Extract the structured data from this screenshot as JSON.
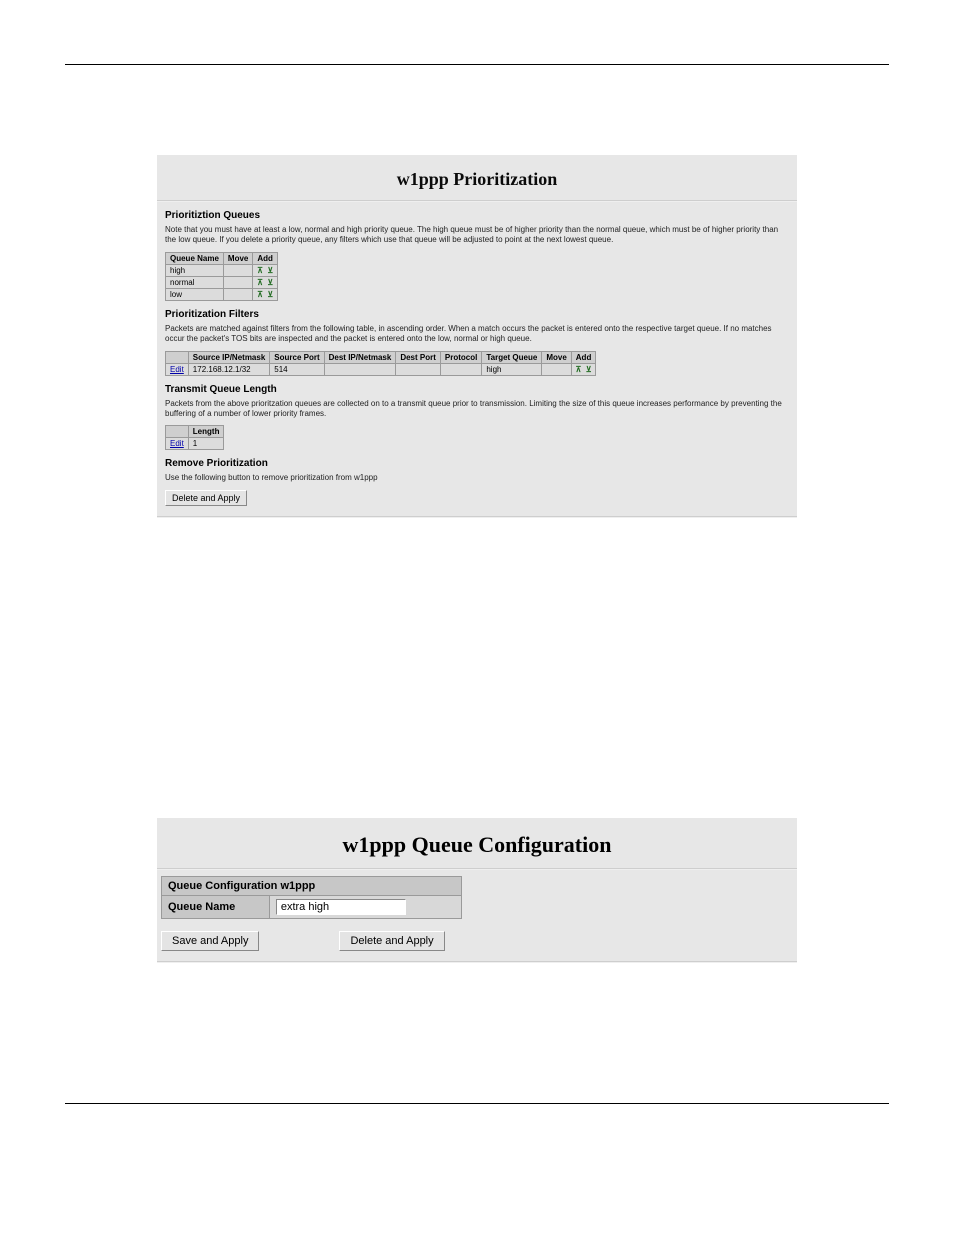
{
  "panel1": {
    "title": "w1ppp Prioritization",
    "sect_queues": {
      "heading": "Prioritiztion Queues",
      "note": "Note that you must have at least a low, normal and high priority queue. The high queue must be of higher priority than the normal queue, which must be of higher priority than the low queue. If you delete a priority queue, any filters which use that queue will be adjusted to point at the next lowest queue.",
      "hdr_name": "Queue Name",
      "hdr_move": "Move",
      "hdr_add": "Add",
      "rows": [
        {
          "name": "high"
        },
        {
          "name": "normal"
        },
        {
          "name": "low"
        }
      ]
    },
    "sect_filters": {
      "heading": "Prioritization Filters",
      "note": "Packets are matched against filters from the following table, in ascending order. When a match occurs the packet is entered onto the respective target queue. If no matches occur the packet's TOS bits are inspected and the packet is entered onto the low, normal or high queue.",
      "hdr_blank": "",
      "hdr_src_ip": "Source IP/Netmask",
      "hdr_src_port": "Source Port",
      "hdr_dest_ip": "Dest IP/Netmask",
      "hdr_dest_port": "Dest Port",
      "hdr_proto": "Protocol",
      "hdr_target": "Target Queue",
      "hdr_move": "Move",
      "hdr_add": "Add",
      "row": {
        "edit": "Edit",
        "src_ip": "172.168.12.1/32",
        "src_port": "514",
        "dest_ip": "",
        "dest_port": "",
        "proto": "",
        "target": "high"
      }
    },
    "sect_tx": {
      "heading": "Transmit Queue Length",
      "note": "Packets from the above prioritzation queues are collected on to a transmit queue prior to transmission. Limiting the size of this queue increases performance by preventing the buffering of a number of lower priority frames.",
      "hdr_length": "Length",
      "edit": "Edit",
      "value": "1"
    },
    "sect_remove": {
      "heading": "Remove Prioritization",
      "note": "Use the following button to remove prioritization from w1ppp",
      "button": "Delete and Apply"
    }
  },
  "panel2": {
    "title": "w1ppp Queue Configuration",
    "cfg_header": "Queue Configuration w1ppp",
    "label_name": "Queue Name",
    "value_name": "extra high",
    "btn_save": "Save and Apply",
    "btn_delete": "Delete and Apply"
  }
}
